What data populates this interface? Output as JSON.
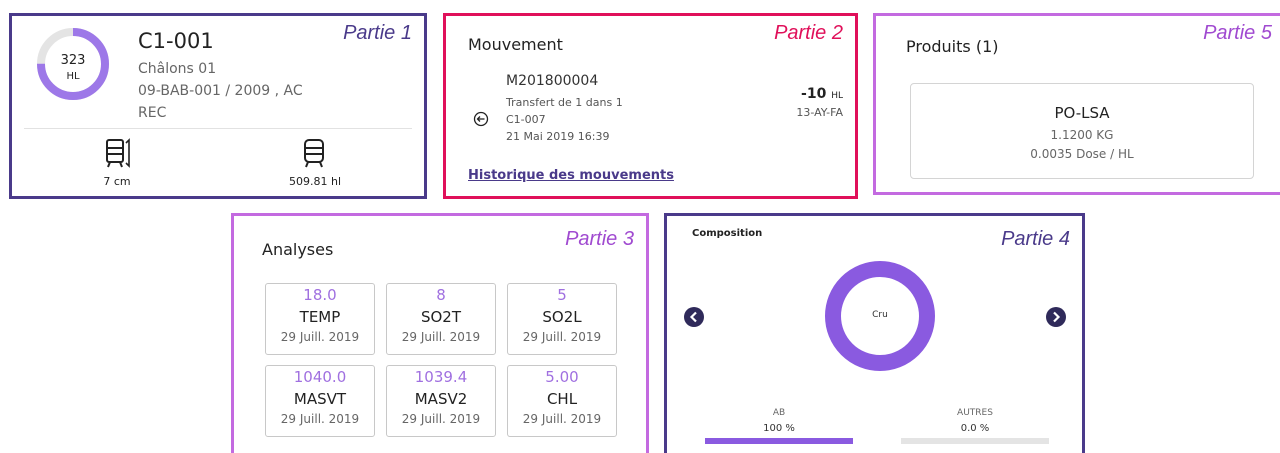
{
  "part1": {
    "tag": "Partie 1",
    "gauge": {
      "value": "323",
      "unit": "HL",
      "fill_fraction": 0.75,
      "color": "#9d78e8"
    },
    "tank": {
      "code": "C1-001",
      "name": "Châlons 01",
      "ref": "09-BAB-001 / 2009 , AC",
      "state": "REC"
    },
    "stats": [
      {
        "icon": "tank-level-icon",
        "value": "7 cm"
      },
      {
        "icon": "tank-capacity-icon",
        "value": "509.81 hl"
      }
    ]
  },
  "part2": {
    "tag": "Partie 2",
    "title": "Mouvement",
    "movement": {
      "code": "M201800004",
      "desc": "Transfert de 1 dans 1",
      "tank": "C1-007",
      "date": "21 Mai 2019 16:39",
      "qty": "-10",
      "qty_unit": "HL",
      "ref": "13-AY-FA",
      "icon": "transfer-icon"
    },
    "history_link": "Historique des mouvements"
  },
  "part5": {
    "tag": "Partie 5",
    "title": "Produits (1)",
    "product": {
      "name": "PO-LSA",
      "qty": "1.1200 KG",
      "dose": "0.0035 Dose / HL"
    }
  },
  "part3": {
    "tag": "Partie 3",
    "title": "Analyses",
    "items": [
      {
        "value": "18.0",
        "name": "TEMP",
        "date": "29 Juill. 2019"
      },
      {
        "value": "8",
        "name": "SO2T",
        "date": "29 Juill. 2019"
      },
      {
        "value": "5",
        "name": "SO2L",
        "date": "29 Juill. 2019"
      },
      {
        "value": "1040.0",
        "name": "MASVT",
        "date": "29 Juill. 2019"
      },
      {
        "value": "1039.4",
        "name": "MASV2",
        "date": "29 Juill. 2019"
      },
      {
        "value": "5.00",
        "name": "CHL",
        "date": "29 Juill. 2019"
      }
    ]
  },
  "part4": {
    "tag": "Partie 4",
    "title": "Composition",
    "donut_label": "Cru",
    "donut_color": "#8a5ae0",
    "legend": [
      {
        "label": "AB",
        "pct": "100 %",
        "fraction": 1.0
      },
      {
        "label": "AUTRES",
        "pct": "0.0 %",
        "fraction": 0.0
      }
    ]
  }
}
